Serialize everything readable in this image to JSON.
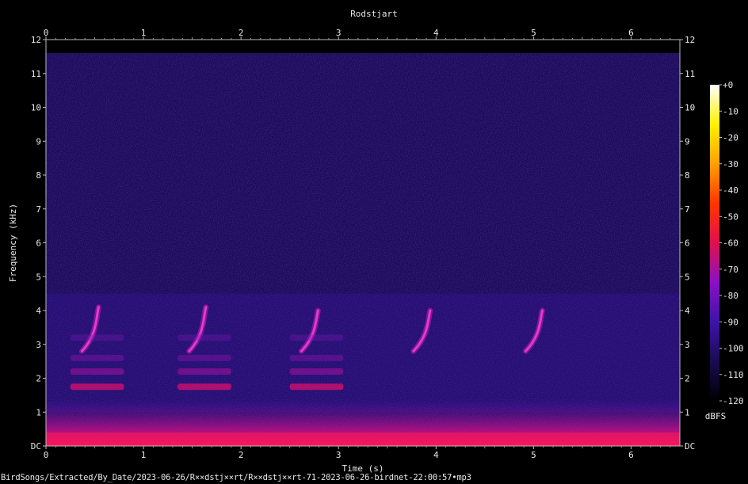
{
  "chart_data": {
    "type": "heatmap",
    "title": "Rodstjart",
    "xlabel": "Time (s)",
    "ylabel": "Frequency (kHz)",
    "xlim": [
      0,
      6.5
    ],
    "ylim": [
      0,
      12
    ],
    "x_ticks": [
      "0",
      "1",
      "2",
      "3",
      "4",
      "5",
      "6"
    ],
    "y_ticks": [
      "DC",
      "1",
      "2",
      "3",
      "4",
      "5",
      "6",
      "7",
      "8",
      "9",
      "10",
      "11",
      "12"
    ],
    "colorbar": {
      "label": "dBFS",
      "range": [
        -120,
        0
      ],
      "ticks": [
        "+0",
        "-10",
        "-20",
        "-30",
        "-40",
        "-50",
        "-60",
        "-70",
        "-80",
        "-90",
        "-100",
        "-110",
        "-120"
      ],
      "colors": [
        "#000000",
        "#1a0b52",
        "#3d14a6",
        "#8a10c4",
        "#e0104d",
        "#ff3500",
        "#ffa000",
        "#fff200",
        "#ffffff"
      ]
    },
    "calls": [
      {
        "t": 0.5,
        "f_low": 2.8,
        "f_high": 4.1
      },
      {
        "t": 1.6,
        "f_low": 2.8,
        "f_high": 4.1
      },
      {
        "t": 2.75,
        "f_low": 2.8,
        "f_high": 4.0
      },
      {
        "t": 3.9,
        "f_low": 2.8,
        "f_high": 4.0
      },
      {
        "t": 5.05,
        "f_low": 2.8,
        "f_high": 4.0
      }
    ]
  },
  "footer": {
    "filepath": "BirdSongs/Extracted/By_Date/2023-06-26/R××dstj××rt/R××dstj××rt-71-2023-06-26-birdnet-22:00:57•mp3"
  }
}
